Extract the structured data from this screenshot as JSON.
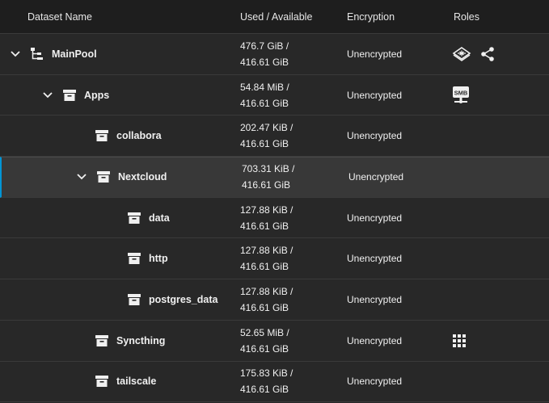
{
  "header": {
    "name": "Dataset Name",
    "used": "Used / Available",
    "encryption": "Encryption",
    "roles": "Roles"
  },
  "rows": [
    {
      "name": "MainPool",
      "used": "476.7 GiB /",
      "available": "416.61 GiB",
      "encryption": "Unencrypted",
      "level": 0,
      "icon": "pool-tree-icon",
      "expanded": true,
      "roles": [
        "dataset-role-icon",
        "share-icon"
      ]
    },
    {
      "name": "Apps",
      "used": "54.84 MiB /",
      "available": "416.61 GiB",
      "encryption": "Unencrypted",
      "level": 1,
      "icon": "dataset-icon",
      "expanded": true,
      "roles": [
        "smb-share-icon"
      ]
    },
    {
      "name": "collabora",
      "used": "202.47 KiB /",
      "available": "416.61 GiB",
      "encryption": "Unencrypted",
      "level": 2,
      "icon": "dataset-icon",
      "roles": []
    },
    {
      "name": "Nextcloud",
      "used": "703.31 KiB /",
      "available": "416.61 GiB",
      "encryption": "Unencrypted",
      "level": 2,
      "icon": "dataset-icon",
      "expanded": true,
      "selected": true,
      "roles": []
    },
    {
      "name": "data",
      "used": "127.88 KiB /",
      "available": "416.61 GiB",
      "encryption": "Unencrypted",
      "level": 3,
      "icon": "dataset-icon",
      "roles": []
    },
    {
      "name": "http",
      "used": "127.88 KiB /",
      "available": "416.61 GiB",
      "encryption": "Unencrypted",
      "level": 3,
      "icon": "dataset-icon",
      "roles": []
    },
    {
      "name": "postgres_data",
      "used": "127.88 KiB /",
      "available": "416.61 GiB",
      "encryption": "Unencrypted",
      "level": 3,
      "icon": "dataset-icon",
      "roles": []
    },
    {
      "name": "Syncthing",
      "used": "52.65 MiB /",
      "available": "416.61 GiB",
      "encryption": "Unencrypted",
      "level": 2,
      "icon": "dataset-icon",
      "roles": [
        "apps-grid-icon"
      ]
    },
    {
      "name": "tailscale",
      "used": "175.83 KiB /",
      "available": "416.61 GiB",
      "encryption": "Unencrypted",
      "level": 2,
      "icon": "dataset-icon",
      "roles": []
    }
  ],
  "labels": {
    "smb": "SMB"
  },
  "colors": {
    "background": "#282828",
    "header_bg": "#1e1e1e",
    "selected_bg": "#383838",
    "accent": "#0095d5",
    "text": "#f0f0f0"
  }
}
